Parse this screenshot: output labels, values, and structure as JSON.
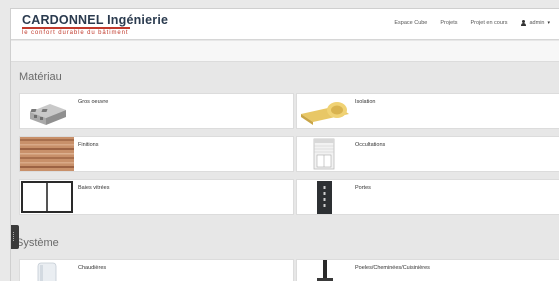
{
  "header": {
    "brand": "CARDONNEL Ingénierie",
    "tagline": "le confort durable du bâtiment"
  },
  "nav": {
    "items": [
      "Espace Cube",
      "Projets",
      "Projet en cours"
    ],
    "admin_label": "admin"
  },
  "sections": [
    {
      "title": "Matériau",
      "cards": [
        {
          "label": "Gros oeuvre",
          "icon": "concrete-block-icon"
        },
        {
          "label": "Isolation",
          "icon": "insulation-roll-icon"
        },
        {
          "label": "Finitions",
          "icon": "wood-texture-icon"
        },
        {
          "label": "Occultations",
          "icon": "roller-shutter-icon"
        },
        {
          "label": "Baies vitrées",
          "icon": "sliding-window-icon"
        },
        {
          "label": "Portes",
          "icon": "door-icon"
        }
      ]
    },
    {
      "title": "Système",
      "cards": [
        {
          "label": "Chaudières",
          "icon": "boiler-icon"
        },
        {
          "label": "Poeles/Cheminées/Cuisinières",
          "icon": "stove-icon"
        }
      ]
    }
  ],
  "colors": {
    "brand_dark": "#2b3b4f",
    "brand_red": "#c0392b",
    "background": "#e7e7e7"
  }
}
